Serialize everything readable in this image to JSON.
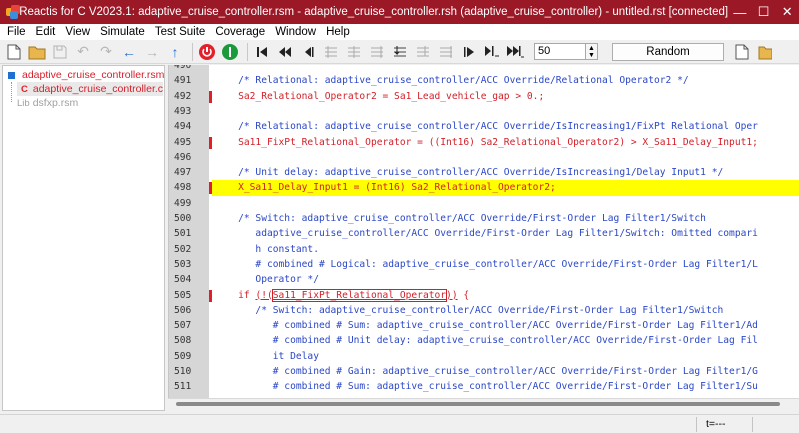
{
  "window": {
    "title": "Reactis for C V2023.1: adaptive_cruise_controller.rsm - adaptive_cruise_controller.rsh (adaptive_cruise_controller) - untitled.rst [connected]",
    "minimize": "—",
    "maximize": "☐",
    "close": "✕"
  },
  "menu": [
    "File",
    "Edit",
    "View",
    "Simulate",
    "Test Suite",
    "Coverage",
    "Window",
    "Help"
  ],
  "toolbar": {
    "steps_value": "50",
    "random_label": "Random",
    "spin_up": "▲",
    "spin_down": "▼"
  },
  "tree": {
    "items": [
      {
        "label": "adaptive_cruise_controller.rsm",
        "type": "model"
      },
      {
        "label": "adaptive_cruise_controller.c",
        "type": "c-file",
        "prefix": "C"
      },
      {
        "label": "dsfxp.rsm",
        "type": "lib",
        "prefix": "Lib"
      }
    ]
  },
  "code": {
    "lines": [
      {
        "n": "490",
        "text": "",
        "style": "plain"
      },
      {
        "n": "491",
        "text": "    /* Relational: adaptive_cruise_controller/ACC Override/Relational Operator2 */",
        "style": "comment"
      },
      {
        "n": "492",
        "text": "    Sa2_Relational_Operator2 = Sa1_Lead_vehicle_gap > 0.;",
        "style": "red",
        "marker": true
      },
      {
        "n": "493",
        "text": "",
        "style": "plain"
      },
      {
        "n": "494",
        "text": "    /* Relational: adaptive_cruise_controller/ACC Override/IsIncreasing1/FixPt Relational Oper",
        "style": "comment"
      },
      {
        "n": "495",
        "text": "    Sa11_FixPt_Relational_Operator = ((Int16) Sa2_Relational_Operator2) > X_Sa11_Delay_Input1;",
        "style": "red",
        "marker": true
      },
      {
        "n": "496",
        "text": "",
        "style": "plain"
      },
      {
        "n": "497",
        "text": "    /* Unit delay: adaptive_cruise_controller/ACC Override/IsIncreasing1/Delay Input1 */",
        "style": "comment"
      },
      {
        "n": "498",
        "text": "    X_Sa11_Delay_Input1 = (Int16) Sa2_Relational_Operator2;",
        "style": "red-hl",
        "marker": true
      },
      {
        "n": "499",
        "text": "",
        "style": "plain"
      },
      {
        "n": "500",
        "text": "    /* Switch: adaptive_cruise_controller/ACC Override/First-Order Lag Filter1/Switch",
        "style": "comment"
      },
      {
        "n": "501",
        "text": "       adaptive_cruise_controller/ACC Override/First-Order Lag Filter1/Switch: Omitted compari",
        "style": "comment"
      },
      {
        "n": "502",
        "text": "       h constant.",
        "style": "comment"
      },
      {
        "n": "503",
        "text": "       # combined # Logical: adaptive_cruise_controller/ACC Override/First-Order Lag Filter1/L",
        "style": "comment"
      },
      {
        "n": "504",
        "text": "       Operator */",
        "style": "comment"
      },
      {
        "n": "505",
        "text": "    if (!(Sa11_FixPt_Relational_Operator)) {",
        "style": "red-if",
        "marker": true
      },
      {
        "n": "506",
        "text": "       /* Switch: adaptive_cruise_controller/ACC Override/First-Order Lag Filter1/Switch",
        "style": "comment"
      },
      {
        "n": "507",
        "text": "          # combined # Sum: adaptive_cruise_controller/ACC Override/First-Order Lag Filter1/Ad",
        "style": "comment"
      },
      {
        "n": "508",
        "text": "          # combined # Unit delay: adaptive_cruise_controller/ACC Override/First-Order Lag Fil",
        "style": "comment"
      },
      {
        "n": "509",
        "text": "          it Delay",
        "style": "comment"
      },
      {
        "n": "510",
        "text": "          # combined # Gain: adaptive_cruise_controller/ACC Override/First-Order Lag Filter1/G",
        "style": "comment"
      },
      {
        "n": "511",
        "text": "          # combined # Sum: adaptive_cruise_controller/ACC Override/First-Order Lag Filter1/Su",
        "style": "comment"
      }
    ]
  },
  "status": {
    "time": "t=---"
  },
  "colors": {
    "titlebar": "#9b1826",
    "comment": "#2b47c7",
    "uncovered": "#d31f28",
    "highlight": "#ffff00"
  }
}
